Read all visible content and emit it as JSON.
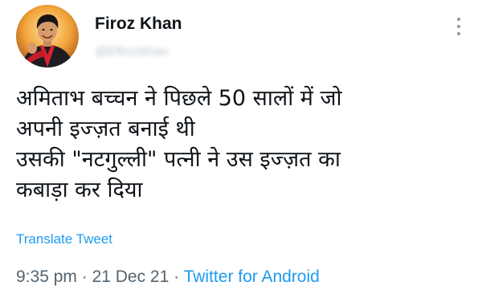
{
  "user": {
    "name": "Firoz Khan",
    "handle": "@Efirozkhan"
  },
  "tweet": {
    "lines": [
      "अमिताभ बच्चन ने पिछले 50 सालों में जो",
      "अपनी इज्ज़त बनाई थी",
      "उसकी \"नटगुल्ली\" पत्नी ने उस इज्ज़त का",
      "कबाड़ा कर दिया"
    ],
    "translate_label": "Translate Tweet"
  },
  "meta": {
    "time": "9:35 pm",
    "separator": " · ",
    "date": "21 Dec 21",
    "source": "Twitter for Android"
  },
  "icons": {
    "more": "more-vertical-icon"
  },
  "colors": {
    "link": "#1d9bf0",
    "secondary_text": "#536471",
    "primary_text": "#0f1419"
  }
}
